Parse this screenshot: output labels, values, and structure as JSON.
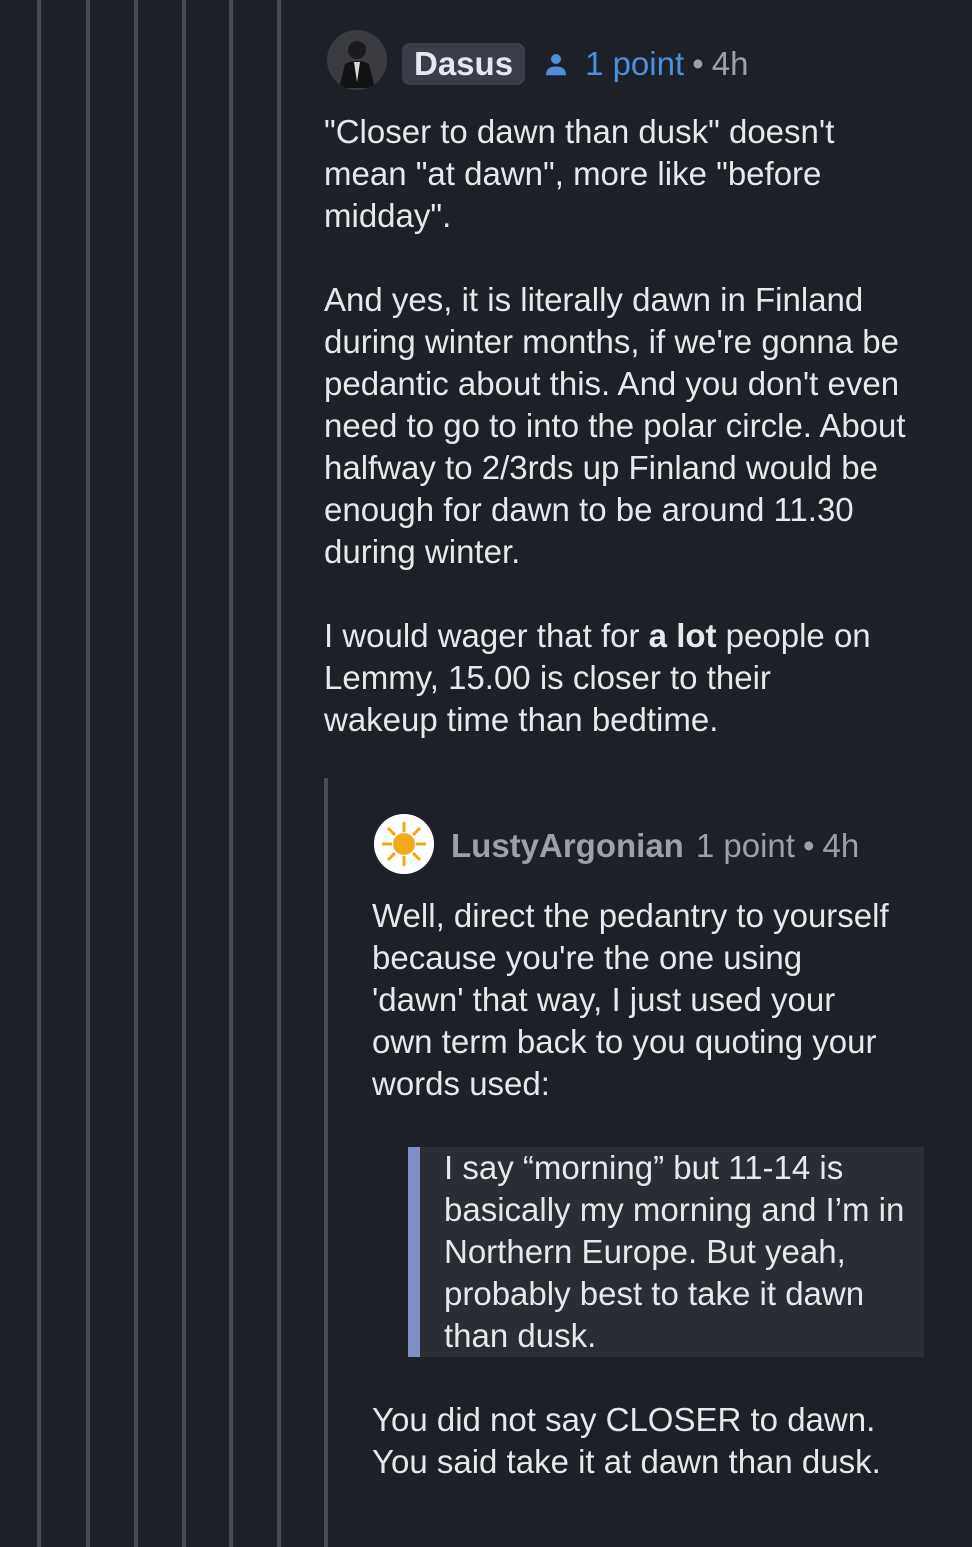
{
  "comment": {
    "author": "Dasus",
    "score": "1 point",
    "separator": "•",
    "age": "4h",
    "p1": "\"Closer to dawn than dusk\" doesn't mean \"at dawn\", more like \"before midday\".",
    "p2": "And yes, it is literally dawn in Finland during winter months, if we're gonna be pedantic about this. And you don't even need to go to into the polar circle. About halfway to 2/3rds up Finland would be enough for dawn to be around 11.30 during winter.",
    "p3_before": "I would wager that for ",
    "p3_bold": "a lot",
    "p3_after": " people on Lemmy, 15.00 is closer to their wakeup time than bedtime."
  },
  "reply": {
    "author": "LustyArgonian",
    "score": "1 point",
    "separator": "•",
    "age": "4h",
    "p1": "Well, direct the pedantry to yourself because you're the one using 'dawn' that way, I just used your own term back to you quoting your words used:",
    "quote": "I say “morning” but 11-14 is basically my morning and I’m in Northern Europe. But yeah, probably best to take it dawn than dusk.",
    "p2": "You did not say CLOSER to dawn. You said take it at dawn than dusk."
  }
}
